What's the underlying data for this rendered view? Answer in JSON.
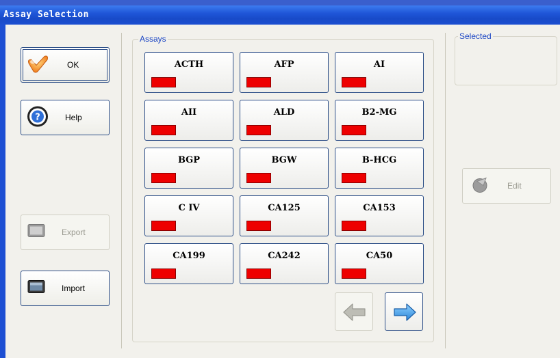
{
  "window": {
    "title": "Assay Selection"
  },
  "buttons": {
    "ok": "OK",
    "help": "Help",
    "export": "Export",
    "import": "Import",
    "edit": "Edit"
  },
  "groups": {
    "assays": "Assays",
    "selected": "Selected"
  },
  "assays": [
    "ACTH",
    "AFP",
    "AI",
    "AII",
    "ALD",
    "B2-MG",
    "BGP",
    "BGW",
    "B-HCG",
    "C IV",
    "CA125",
    "CA153",
    "CA199",
    "CA242",
    "CA50"
  ],
  "colors": {
    "swatch": "#ee0000",
    "title_bar": "#1f56d8",
    "accent_blue": "#1c46c4",
    "arrow_next": "#3a9ae6",
    "arrow_prev_disabled": "#b8b8b0"
  }
}
